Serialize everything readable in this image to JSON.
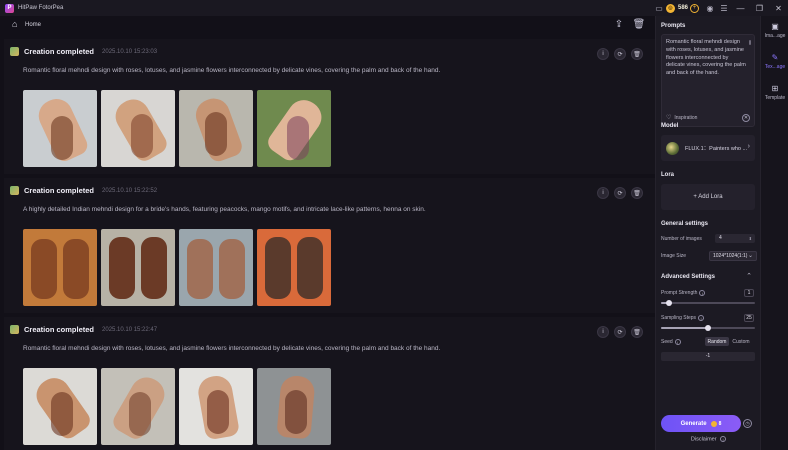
{
  "app": {
    "title": "HitPaw FotorPea",
    "logo_letter": "P"
  },
  "titlebar": {
    "credits": "586",
    "icons": [
      "cart-icon",
      "coin-icon",
      "add-credits-icon",
      "user-icon",
      "menu-icon"
    ],
    "window_controls": [
      "minimize-icon",
      "maximize-icon",
      "close-icon"
    ]
  },
  "homebar": {
    "label": "Home",
    "actions": [
      "export-icon",
      "delete-icon"
    ]
  },
  "feed": [
    {
      "title": "Creation completed",
      "time": "2025.10.10   15:23:03",
      "desc": "Romantic floral mehndi design with roses, lotuses, and jasmine flowers interconnected by delicate vines, covering the palm and back of the hand."
    },
    {
      "title": "Creation completed",
      "time": "2025.10.10   15:22:52",
      "desc": "A highly detailed Indian mehndi design for a bride's hands, featuring peacocks, mango motifs, and intricate lace-like patterns, henna on skin."
    },
    {
      "title": "Creation completed",
      "time": "2025.10.10   15:22:47",
      "desc": "Romantic floral mehndi design with roses, lotuses, and jasmine flowers interconnected by delicate vines, covering the palm and back of the hand."
    }
  ],
  "panel": {
    "prompts_title": "Prompts",
    "prompt_text": "Romantic floral mehndi design with roses, lotuses, and jasmine flowers interconnected by delicate vines, covering the palm and back of the hand.",
    "inspiration": "Inspiration",
    "model_title": "Model",
    "model_name": "FLUX.1：Painters who ...",
    "lora_title": "Lora",
    "lora_add": "+ Add Lora",
    "general_title": "General settings",
    "num_images_label": "Number of images",
    "num_images_value": "4",
    "image_size_label": "Image Size",
    "image_size_value": "1024*1024(1:1)",
    "advanced_title": "Advanced Settings",
    "prompt_strength_label": "Prompt Strength",
    "prompt_strength_value": "1",
    "prompt_strength_fraction": 0.08,
    "sampling_label": "Sampling Steps",
    "sampling_value": "25",
    "sampling_fraction": 0.5,
    "seed_label": "Seed",
    "seed_random": "Random",
    "seed_custom": "Custom",
    "seed_value": "-1",
    "generate_label": "Generate",
    "generate_cost": "8",
    "disclaimer": "Disclaimer"
  },
  "sidetabs": [
    {
      "label": "Ima...age",
      "icon": "image-icon"
    },
    {
      "label": "Tex...age",
      "icon": "text-edit-icon",
      "active": true
    },
    {
      "label": "Template",
      "icon": "template-icon"
    }
  ],
  "colors": {
    "accent": "#7c5cf6",
    "coin": "#f3b534",
    "background": "#121018",
    "panel": "#1c1a23"
  }
}
